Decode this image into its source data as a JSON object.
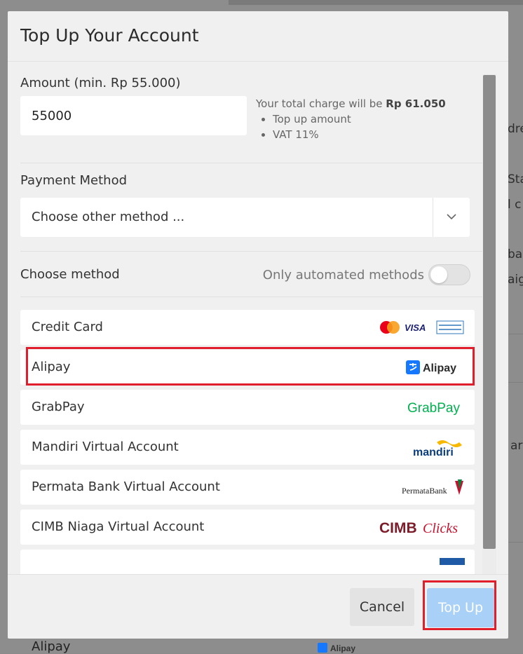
{
  "modal": {
    "title": "Top Up Your Account",
    "amount_label": "Amount (min. Rp 55.000)",
    "amount_value": "55000",
    "charge_prefix": "Your total charge will be",
    "charge_total": "Rp 61.050",
    "charge_items": [
      "Top up amount",
      "VAT 11%"
    ],
    "payment_method_label": "Payment Method",
    "payment_method_selected": "Choose other method ...",
    "choose_method_label": "Choose method",
    "automated_toggle_label": "Only automated methods",
    "automated_toggle_on": false,
    "methods": [
      {
        "name": "Credit Card",
        "logo": "credit-card-brands-logo"
      },
      {
        "name": "Alipay",
        "logo": "alipay-logo"
      },
      {
        "name": "GrabPay",
        "logo": "grabpay-logo"
      },
      {
        "name": "Mandiri Virtual Account",
        "logo": "mandiri-logo"
      },
      {
        "name": "Permata Bank Virtual Account",
        "logo": "permatabank-logo"
      },
      {
        "name": "CIMB Niaga Virtual Account",
        "logo": "cimb-clicks-logo"
      }
    ],
    "logo_text": {
      "alipay": "Alipay",
      "grabpay": "GrabPay",
      "mandiri": "mandiri",
      "permata": "PermataBank",
      "cimb": "CIMB",
      "cimb_clicks": "Clicks",
      "visa": "VISA"
    },
    "cancel_label": "Cancel",
    "topup_label": "Top Up"
  },
  "background": {
    "fragments": [
      "dre",
      "Sta",
      "l c",
      "ba",
      "aig",
      "ar"
    ],
    "alipay_text": "Alipay"
  },
  "colors": {
    "highlight": "#e11e2b",
    "topup_button": "#a9d0f6",
    "grabpay_green": "#00b14f",
    "cimb_red": "#7c1c2a"
  }
}
